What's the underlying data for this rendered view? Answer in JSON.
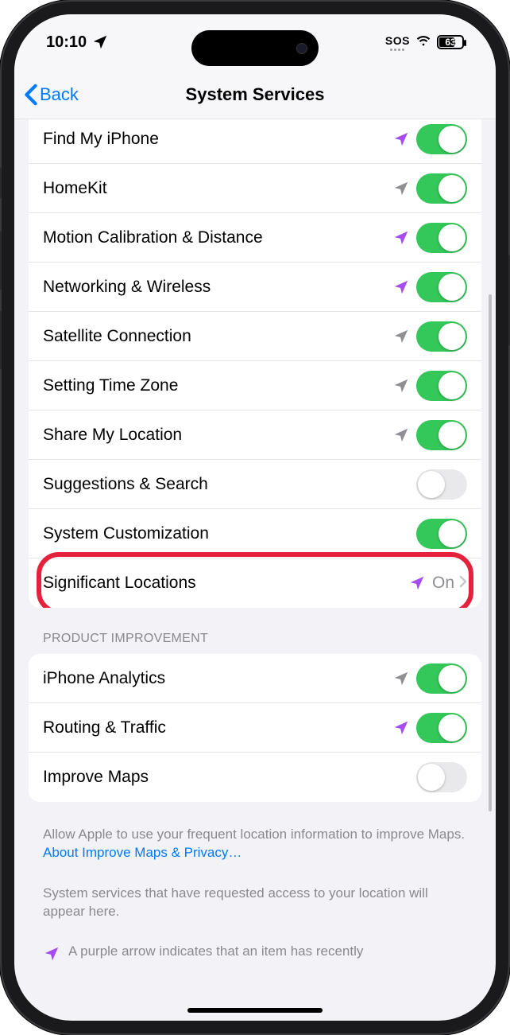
{
  "status": {
    "time": "10:10",
    "sos": "SOS",
    "battery_pct": "63"
  },
  "nav": {
    "back": "Back",
    "title": "System Services"
  },
  "services": {
    "rows": [
      {
        "label": "Find My iPhone",
        "arrow": "purple",
        "toggle": "on"
      },
      {
        "label": "HomeKit",
        "arrow": "gray",
        "toggle": "on"
      },
      {
        "label": "Motion Calibration & Distance",
        "arrow": "purple",
        "toggle": "on"
      },
      {
        "label": "Networking & Wireless",
        "arrow": "purple",
        "toggle": "on"
      },
      {
        "label": "Satellite Connection",
        "arrow": "gray",
        "toggle": "on"
      },
      {
        "label": "Setting Time Zone",
        "arrow": "gray",
        "toggle": "on"
      },
      {
        "label": "Share My Location",
        "arrow": "gray",
        "toggle": "on"
      },
      {
        "label": "Suggestions & Search",
        "arrow": "none",
        "toggle": "off"
      },
      {
        "label": "System Customization",
        "arrow": "none",
        "toggle": "on"
      }
    ],
    "link_row": {
      "label": "Significant Locations",
      "arrow": "purple",
      "detail": "On"
    }
  },
  "product_improvement": {
    "header": "PRODUCT IMPROVEMENT",
    "rows": [
      {
        "label": "iPhone Analytics",
        "arrow": "gray",
        "toggle": "on"
      },
      {
        "label": "Routing & Traffic",
        "arrow": "purple",
        "toggle": "on"
      },
      {
        "label": "Improve Maps",
        "arrow": "none",
        "toggle": "off"
      }
    ],
    "footer_prefix": "Allow Apple to use your frequent location information to improve Maps. ",
    "footer_link": "About Improve Maps & Privacy…"
  },
  "footer2": "System services that have requested access to your location will appear here.",
  "legend_purple": "A purple arrow indicates that an item has recently"
}
